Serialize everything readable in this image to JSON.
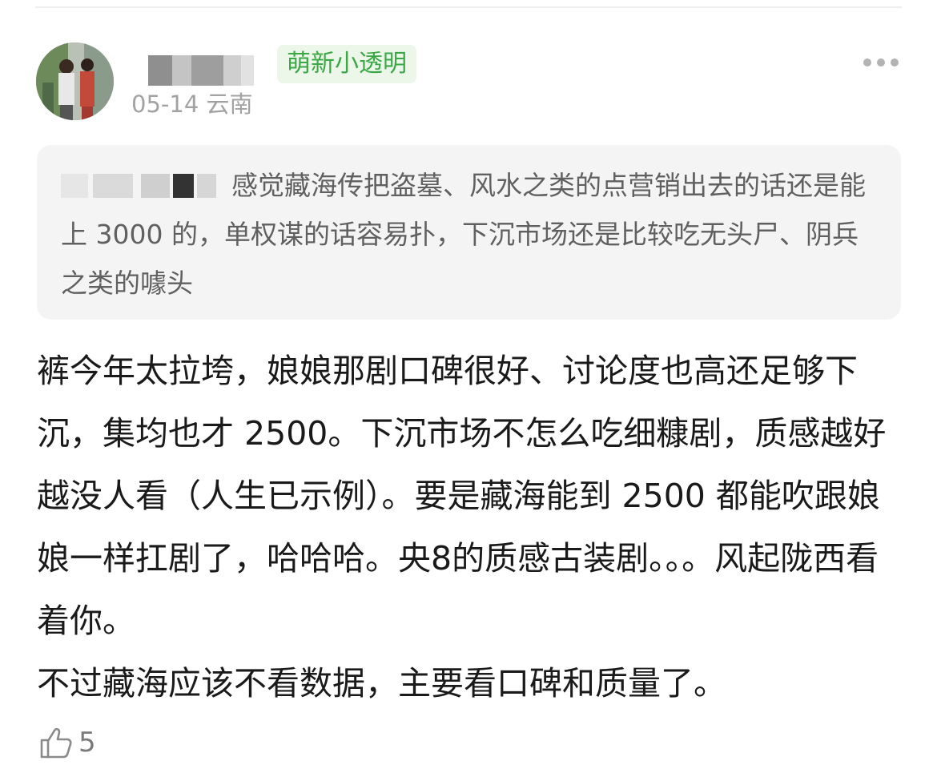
{
  "post": {
    "author_badge": "萌新小透明",
    "meta": "05-14 云南",
    "quoted_text": "感觉藏海传把盗墓、风水之类的点营销出去的话还是能上 3000 的，单权谋的话容易扑，下沉市场还是比较吃无头尸、阴兵之类的噱头",
    "body_text": "裤今年太拉垮，娘娘那剧口碑很好、讨论度也高还足够下沉，集均也才 2500。下沉市场不怎么吃细糠剧，质感越好越没人看（人生已示例）。要是藏海能到 2500 都能吹跟娘娘一样扛剧了，哈哈哈。央8的质感古装剧。。。风起陇西看着你。\n不过藏海应该不看数据，主要看口碑和质量了。",
    "like_count": "5"
  },
  "icons": {
    "more": "more-horizontal-icon",
    "like": "thumbs-up-icon"
  },
  "colors": {
    "badge_text": "#3aa845",
    "badge_bg": "#ecf7ea",
    "meta_text": "#a2a2a2",
    "quote_bg": "#f4f4f4"
  }
}
